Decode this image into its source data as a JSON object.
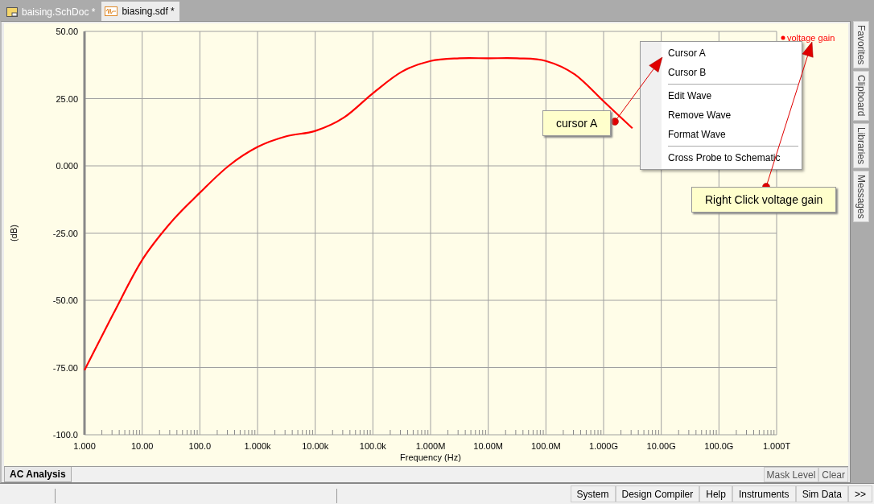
{
  "tabs": [
    {
      "label": "baising.SchDoc *",
      "kind": "schematic",
      "selected": false
    },
    {
      "label": "biasing.sdf *",
      "kind": "waveform",
      "selected": true
    }
  ],
  "chart": {
    "chart_data": {
      "type": "line",
      "xlabel": "Frequency (Hz)",
      "ylabel": "(dB)",
      "categories": [
        "1.000",
        null,
        "10.00",
        null,
        "100.0",
        null,
        "1.000k",
        null,
        "10.00k",
        null,
        "100.0k",
        null,
        "1.000M",
        null,
        "10.00M",
        null,
        "100.0M",
        null,
        "1.000G",
        null,
        "10.00G",
        null,
        "100.0G",
        null,
        "1.000T"
      ],
      "series": [
        {
          "name": "voltage gain",
          "color": "#ff0000",
          "values": [
            -76,
            -55,
            -35,
            -21,
            -10,
            0,
            7,
            11,
            13,
            18,
            27,
            35,
            39,
            40,
            40,
            40,
            39,
            34,
            24,
            14,
            null,
            null,
            null,
            null,
            null
          ]
        }
      ],
      "ylim": [
        -100,
        50
      ],
      "grid": true,
      "yticks": [
        {
          "value": 50,
          "label": "50.00"
        },
        {
          "value": 25,
          "label": "25.00"
        },
        {
          "value": 0,
          "label": "0.000"
        },
        {
          "value": -25,
          "label": "-25.00"
        },
        {
          "value": -50,
          "label": "-50.00"
        },
        {
          "value": -75,
          "label": "-75.00"
        },
        {
          "value": -100,
          "label": "-100.0"
        }
      ]
    }
  },
  "context_menu": {
    "groups": [
      [
        "Cursor A",
        "Cursor B"
      ],
      [
        "Edit Wave",
        "Remove Wave",
        "Format Wave"
      ],
      [
        "Cross Probe to Schematic"
      ]
    ]
  },
  "callouts": [
    {
      "text": "cursor A"
    },
    {
      "text": "Right Click voltage gain"
    }
  ],
  "analysis_tabs": [
    {
      "label": "AC Analysis",
      "selected": true
    }
  ],
  "chart_buttons": [
    "Mask Level",
    "Clear"
  ],
  "side_panels": [
    "Favorites",
    "Clipboard",
    "Libraries",
    "Messages"
  ],
  "status_bar": {
    "buttons": [
      "System",
      "Design Compiler",
      "Help",
      "Instruments",
      "Sim Data",
      ">>"
    ]
  }
}
